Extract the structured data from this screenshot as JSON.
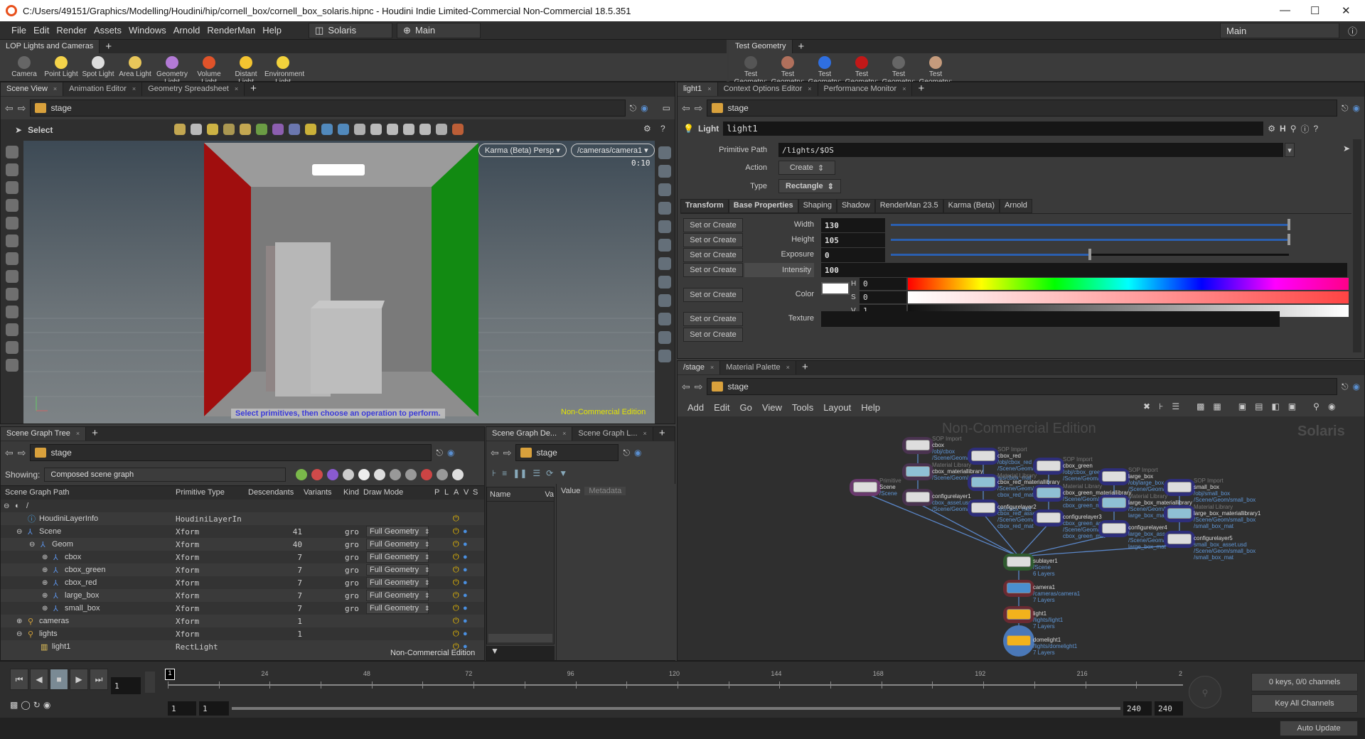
{
  "title_bar": {
    "title": "C:/Users/49151/Graphics/Modelling/Houdini/hip/cornell_box/cornell_box_solaris.hipnc - Houdini Indie Limited-Commercial Non-Commercial 18.5.351"
  },
  "menu": {
    "items": [
      "File",
      "Edit",
      "Render",
      "Assets",
      "Windows",
      "Arnold",
      "RenderMan",
      "Help"
    ],
    "desktop": "Solaris",
    "viewport_layout": "Main",
    "right_desktop": "Main"
  },
  "shelf_left": {
    "tab": "LOP Lights and Cameras",
    "tools": [
      {
        "label": "Camera",
        "color": "#666"
      },
      {
        "label": "Point Light",
        "color": "#f4d34a"
      },
      {
        "label": "Spot Light",
        "color": "#ddd"
      },
      {
        "label": "Area Light",
        "color": "#e8c65a"
      },
      {
        "label": "Geometry Light",
        "color": "#b37ad6"
      },
      {
        "label": "Volume Light",
        "color": "#e0532a"
      },
      {
        "label": "Distant Light",
        "color": "#f4c430"
      },
      {
        "label": "Environment Light",
        "color": "#f2d23c"
      }
    ]
  },
  "shelf_right": {
    "tab": "Test Geometry",
    "tools": [
      {
        "label": "Test Geometry: C...",
        "color": "#555"
      },
      {
        "label": "Test Geometry: P...",
        "color": "#b0705c"
      },
      {
        "label": "Test Geometry: R...",
        "color": "#2f6fe0"
      },
      {
        "label": "Test Geometry: S...",
        "color": "#c21818"
      },
      {
        "label": "Test Geometry: S...",
        "color": "#666"
      },
      {
        "label": "Test Geometry: T...",
        "color": "#c59b7c"
      }
    ]
  },
  "scene_view": {
    "tabs": [
      "Scene View",
      "Animation Editor",
      "Geometry Spreadsheet"
    ],
    "path": "stage",
    "tool": "Select",
    "renderer": "Karma (Beta)  Persp",
    "camera": "/cameras/camera1",
    "render_time": "0:10",
    "hint": "Select primitives, then choose an operation to perform.",
    "watermark": "Non-Commercial Edition"
  },
  "scene_graph_tree": {
    "tab": "Scene Graph Tree",
    "path": "stage",
    "showing_label": "Showing:",
    "showing_value": "Composed scene graph",
    "columns": [
      "Scene Graph Path",
      "Primitive Type",
      "Descendants",
      "Variants",
      "Kind",
      "Draw Mode",
      "P",
      "L",
      "A",
      "V",
      "S"
    ],
    "rows": [
      {
        "name": "/",
        "depth": 0,
        "type": "",
        "descendants": "",
        "kind": "",
        "draw_mode": "",
        "icon": "root"
      },
      {
        "name": "HoudiniLayerInfo",
        "depth": 1,
        "type": "HoudiniLayerIn",
        "descendants": "",
        "kind": "",
        "draw_mode": "",
        "icon": "info"
      },
      {
        "name": "Scene",
        "depth": 1,
        "type": "Xform",
        "descendants": "41",
        "kind": "gro",
        "draw_mode": "Full Geometry",
        "icon": "xform"
      },
      {
        "name": "Geom",
        "depth": 2,
        "type": "Xform",
        "descendants": "40",
        "kind": "gro",
        "draw_mode": "Full Geometry",
        "icon": "xform"
      },
      {
        "name": "cbox",
        "depth": 3,
        "type": "Xform",
        "descendants": "7",
        "kind": "gro",
        "draw_mode": "Full Geometry",
        "icon": "xform"
      },
      {
        "name": "cbox_green",
        "depth": 3,
        "type": "Xform",
        "descendants": "7",
        "kind": "gro",
        "draw_mode": "Full Geometry",
        "icon": "xform"
      },
      {
        "name": "cbox_red",
        "depth": 3,
        "type": "Xform",
        "descendants": "7",
        "kind": "gro",
        "draw_mode": "Full Geometry",
        "icon": "xform"
      },
      {
        "name": "large_box",
        "depth": 3,
        "type": "Xform",
        "descendants": "7",
        "kind": "gro",
        "draw_mode": "Full Geometry",
        "icon": "xform"
      },
      {
        "name": "small_box",
        "depth": 3,
        "type": "Xform",
        "descendants": "7",
        "kind": "gro",
        "draw_mode": "Full Geometry",
        "icon": "xform"
      },
      {
        "name": "cameras",
        "depth": 1,
        "type": "Xform",
        "descendants": "1",
        "kind": "",
        "draw_mode": "",
        "icon": "camera"
      },
      {
        "name": "lights",
        "depth": 1,
        "type": "Xform",
        "descendants": "1",
        "kind": "",
        "draw_mode": "",
        "icon": "camera"
      },
      {
        "name": "light1",
        "depth": 2,
        "type": "RectLight",
        "descendants": "",
        "kind": "",
        "draw_mode": "",
        "icon": "light"
      }
    ],
    "watermark": "Non-Commercial Edition"
  },
  "scene_graph_details": {
    "tabs": [
      "Scene Graph De...",
      "Scene Graph L..."
    ],
    "path": "stage",
    "columns": [
      "Name",
      "Va"
    ],
    "value_tabs": [
      "Value",
      "Metadata"
    ]
  },
  "params": {
    "tabs": [
      "light1",
      "Context Options Editor",
      "Performance Monitor"
    ],
    "path": "stage",
    "node_type": "Light",
    "node_name": "light1",
    "primitive_path_label": "Primitive Path",
    "primitive_path": "/lights/$OS",
    "action_label": "Action",
    "action": "Create",
    "type_label": "Type",
    "type": "Rectangle",
    "param_tabs": [
      "Transform",
      "Base Properties",
      "Shaping",
      "Shadow",
      "RenderMan 23.5",
      "Karma (Beta)",
      "Arnold"
    ],
    "active_param_tab": "Base Properties",
    "set_or_create": "Set or Create",
    "width": {
      "label": "Width",
      "value": "130",
      "slider": 1.0
    },
    "height": {
      "label": "Height",
      "value": "105",
      "slider": 1.0
    },
    "exposure": {
      "label": "Exposure",
      "value": "0",
      "slider": 0.5
    },
    "intensity": {
      "label": "Intensity",
      "value": "100"
    },
    "color": {
      "label": "Color",
      "h_label": "H",
      "h": "0",
      "s_label": "S",
      "s": "0",
      "v_label": "V",
      "v": "1",
      "swatch": "#ffffff"
    },
    "texture": {
      "label": "Texture",
      "value": ""
    }
  },
  "network": {
    "tabs": [
      "/stage",
      "Material Palette"
    ],
    "path": "stage",
    "menu": [
      "Add",
      "Edit",
      "Go",
      "View",
      "Tools",
      "Layout",
      "Help"
    ],
    "watermark": "Non-Commercial Edition",
    "context": "Solaris",
    "nodes": [
      {
        "id": "cbox",
        "type": "SOP Import",
        "name": "cbox",
        "sub": [
          "/obj/cbox",
          "/Scene/Geom/cbox"
        ],
        "ring": "#4a3350"
      },
      {
        "id": "cbox_materiallibrary",
        "type": "Material Library",
        "name": "cbox_materiallibrary",
        "sub": [
          "/Scene/Geom/cbox/materials/cbox_mat"
        ],
        "ring": "#4a3350"
      },
      {
        "id": "configurelayer1",
        "type": "",
        "name": "configurelayer1",
        "sub": [
          "cbox_asset.usd",
          "/Scene/Geom/cbox/materials/cbox_mat"
        ],
        "ring": "#4a3350"
      },
      {
        "id": "scene",
        "type": "Primitive",
        "name": "Scene",
        "sub": [
          "/Scene"
        ],
        "ring": "#6a3a6e"
      },
      {
        "id": "cbox_red",
        "type": "SOP Import",
        "name": "cbox_red",
        "sub": [
          "/obj/cbox_red",
          "/Scene/Geom/cbox_red"
        ],
        "ring": "#2e2e7a"
      },
      {
        "id": "cbox_red_materiallibrary",
        "type": "Material Library",
        "name": "cbox_red_materiallibrary",
        "sub": [
          "/Scene/Geom/cbox_red/",
          "cbox_red_mat"
        ],
        "ring": "#2e2e7a"
      },
      {
        "id": "configurelayer2",
        "type": "",
        "name": "configurelayer2",
        "sub": [
          "cbox_red_asset.usd",
          "/Scene/Geom/cbox_red/",
          "cbox_red_mat"
        ],
        "ring": "#2e2e7a"
      },
      {
        "id": "cbox_green",
        "type": "SOP Import",
        "name": "cbox_green",
        "sub": [
          "/obj/cbox_green",
          "/Scene/Geom/cbox_green"
        ],
        "ring": "#2e2e7a"
      },
      {
        "id": "cbox_green_materiallibrary",
        "type": "Material Library",
        "name": "cbox_green_materiallibrary",
        "sub": [
          "/Scene/Geom/cbox_green/",
          "cbox_green_mat"
        ],
        "ring": "#2e2e7a"
      },
      {
        "id": "configurelayer3",
        "type": "",
        "name": "configurelayer3",
        "sub": [
          "cbox_green_asset.usd",
          "/Scene/Geom/cbox_green/",
          "cbox_green_mat"
        ],
        "ring": "#2e2e7a"
      },
      {
        "id": "large_box",
        "type": "SOP Import",
        "name": "large_box",
        "sub": [
          "/obj/large_box",
          "/Scene/Geom/large_box"
        ],
        "ring": "#2e2e7a"
      },
      {
        "id": "large_box_materiallibrary",
        "type": "Material Library",
        "name": "large_box_materiallibrary",
        "sub": [
          "/Scene/Geom/large_box/",
          "large_box_mat"
        ],
        "ring": "#2e2e7a"
      },
      {
        "id": "configurelayer4",
        "type": "",
        "name": "configurelayer4",
        "sub": [
          "large_box_asset.usd",
          "/Scene/Geom/large_box/",
          "large_box_mat"
        ],
        "ring": "#2e2e7a"
      },
      {
        "id": "small_box",
        "type": "SOP Import",
        "name": "small_box",
        "sub": [
          "/obj/small_box",
          "/Scene/Geom/small_box"
        ],
        "ring": "#2e2e7a"
      },
      {
        "id": "small_box_materiallibrary",
        "type": "Material Library",
        "name": "large_box_materiallibrary1",
        "sub": [
          "/Scene/Geom/small_box",
          "/small_box_mat"
        ],
        "ring": "#2e2e7a"
      },
      {
        "id": "configurelayer5",
        "type": "",
        "name": "configurelayer5",
        "sub": [
          "small_box_asset.usd",
          "/Scene/Geom/small_box",
          "/small_box_mat"
        ],
        "ring": "#2e2e7a"
      },
      {
        "id": "sublayer1",
        "type": "",
        "name": "sublayer1",
        "sub": [
          "/Scene",
          "6 Layers"
        ],
        "ring": "#2f5a2f"
      },
      {
        "id": "camera1",
        "type": "",
        "name": "camera1",
        "sub": [
          "/cameras/camera1",
          "7 Layers"
        ],
        "ring": "#6a2a32"
      },
      {
        "id": "light1",
        "type": "",
        "name": "light1",
        "sub": [
          "/lights/light1",
          "7 Layers"
        ],
        "ring": "#6a2a32"
      },
      {
        "id": "domelight1",
        "type": "",
        "name": "domelight1",
        "sub": [
          "/lights/domelight1",
          "7 Layers"
        ],
        "ring": "#4a78b8"
      }
    ]
  },
  "timeline": {
    "tick_labels": [
      "24",
      "48",
      "72",
      "96",
      "120",
      "144",
      "168",
      "192",
      "216",
      "2"
    ],
    "current_frame": "1",
    "frame_marker": "1",
    "range_start": "1",
    "range_start2": "1",
    "range_end": "240",
    "range_end2": "240",
    "frame_min": 1,
    "frame_max": 240,
    "keys_info": "0 keys, 0/0 channels",
    "key_all": "Key All Channels"
  },
  "status": {
    "update_mode": "Auto Update"
  }
}
